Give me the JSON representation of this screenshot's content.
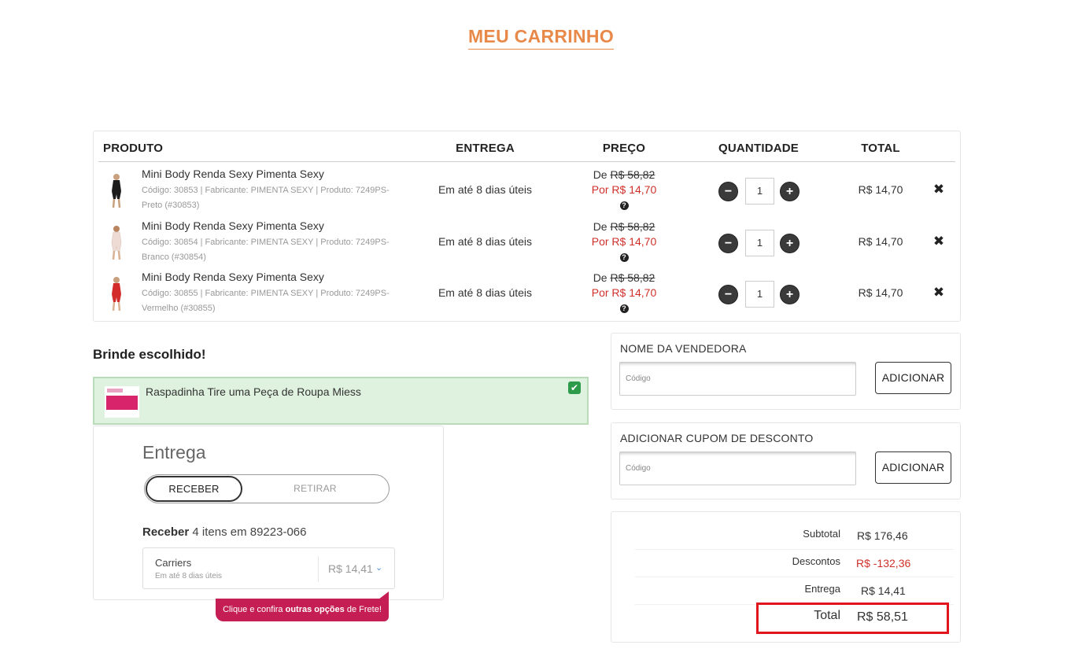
{
  "page_title": "MEU CARRINHO",
  "table": {
    "headers": [
      "PRODUTO",
      "ENTREGA",
      "PREÇO",
      "QUANTIDADE",
      "TOTAL"
    ],
    "rows": [
      {
        "name": "Mini Body Renda Sexy Pimenta Sexy",
        "desc": "Código: 30853 | Fabricante: PIMENTA SEXY | Produto: 7249PS-Preto (#30853)",
        "delivery": "Em até 8 dias úteis",
        "price_de_label": "De ",
        "price_old": "R$ 58,82",
        "price_new": "Por R$ 14,70",
        "qty": "1",
        "total": "R$ 14,70",
        "thumb_color": "#1c1c1c"
      },
      {
        "name": "Mini Body Renda Sexy Pimenta Sexy",
        "desc": "Código: 30854 | Fabricante: PIMENTA SEXY | Produto: 7249PS-Branco (#30854)",
        "delivery": "Em até 8 dias úteis",
        "price_de_label": "De ",
        "price_old": "R$ 58,82",
        "price_new": "Por R$ 14,70",
        "qty": "1",
        "total": "R$ 14,70",
        "thumb_color": "#eedcd4"
      },
      {
        "name": "Mini Body Renda Sexy Pimenta Sexy",
        "desc": "Código: 30855 | Fabricante: PIMENTA SEXY | Produto: 7249PS-Vermelho (#30855)",
        "delivery": "Em até 8 dias úteis",
        "price_de_label": "De ",
        "price_old": "R$ 58,82",
        "price_new": "Por R$ 14,70",
        "qty": "1",
        "total": "R$ 14,70",
        "thumb_color": "#d32a2a"
      }
    ],
    "minus_symbol": "−",
    "plus_symbol": "+",
    "remove_symbol": "✖",
    "help_symbol": "?"
  },
  "brinde": {
    "title": "Brinde escolhido!",
    "item_name": "Raspadinha Tire uma Peça de Roupa Miess",
    "check_symbol": "✔"
  },
  "shipping": {
    "title": "Entrega",
    "option_receive": "RECEBER",
    "option_pickup": "RETIRAR",
    "receive_label": "Receber",
    "receive_text": " 4 itens em ",
    "cep": "89223-066",
    "carrier_name": "Carriers",
    "carrier_eta": "Em até 8 dias úteis",
    "carrier_price": "R$ 14,41",
    "chevron": "⌄",
    "banner_pre": "Clique e confira ",
    "banner_bold": "outras opções",
    "banner_post": " de Frete!"
  },
  "seller": {
    "title": "NOME DA VENDEDORA",
    "placeholder": "Código",
    "button": "ADICIONAR"
  },
  "coupon": {
    "title": "ADICIONAR CUPOM DE DESCONTO",
    "placeholder": "Código",
    "button": "ADICIONAR"
  },
  "summary": {
    "subtotal_label": "Subtotal",
    "subtotal_value": "R$ 176,46",
    "discount_label": "Descontos",
    "discount_value": "R$ -132,36",
    "delivery_label": "Entrega",
    "delivery_value": "R$ 14,41",
    "total_label": "Total",
    "total_value": "R$ 58,51"
  },
  "colors": {
    "accent_title": "#e8894a",
    "price_red": "#d0302a",
    "brinde_bg": "#dff2df",
    "banner": "#c41e54",
    "highlight": "#e0161c"
  }
}
